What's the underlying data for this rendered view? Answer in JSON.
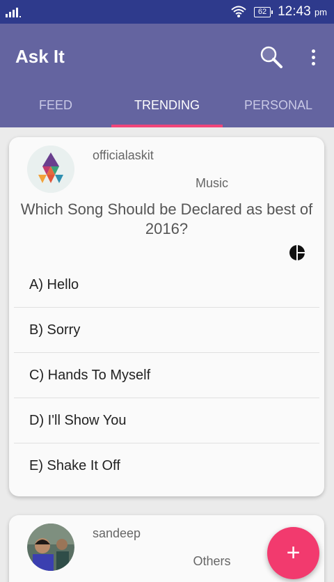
{
  "status_bar": {
    "battery": "62",
    "time": "12:43",
    "time_suffix": "pm"
  },
  "app_bar": {
    "title": "Ask It",
    "tabs": [
      {
        "label": "FEED"
      },
      {
        "label": "TRENDING"
      },
      {
        "label": "PERSONAL"
      }
    ],
    "active_tab": "TRENDING"
  },
  "feed": {
    "posts": [
      {
        "username": "officialaskit",
        "category": "Music",
        "question": "Which Song Should be Declared as best of 2016?",
        "options": [
          "A) Hello",
          "B) Sorry",
          "C) Hands To Myself",
          "D) I'll Show You",
          "E) Shake It Off"
        ]
      },
      {
        "username": "sandeep",
        "category": "Others"
      }
    ]
  },
  "fab": {
    "label": "+"
  },
  "colors": {
    "status_bar": "#2e3a8c",
    "app_bar": "#6464a0",
    "accent": "#f0457a",
    "fab": "#f23a6e"
  }
}
